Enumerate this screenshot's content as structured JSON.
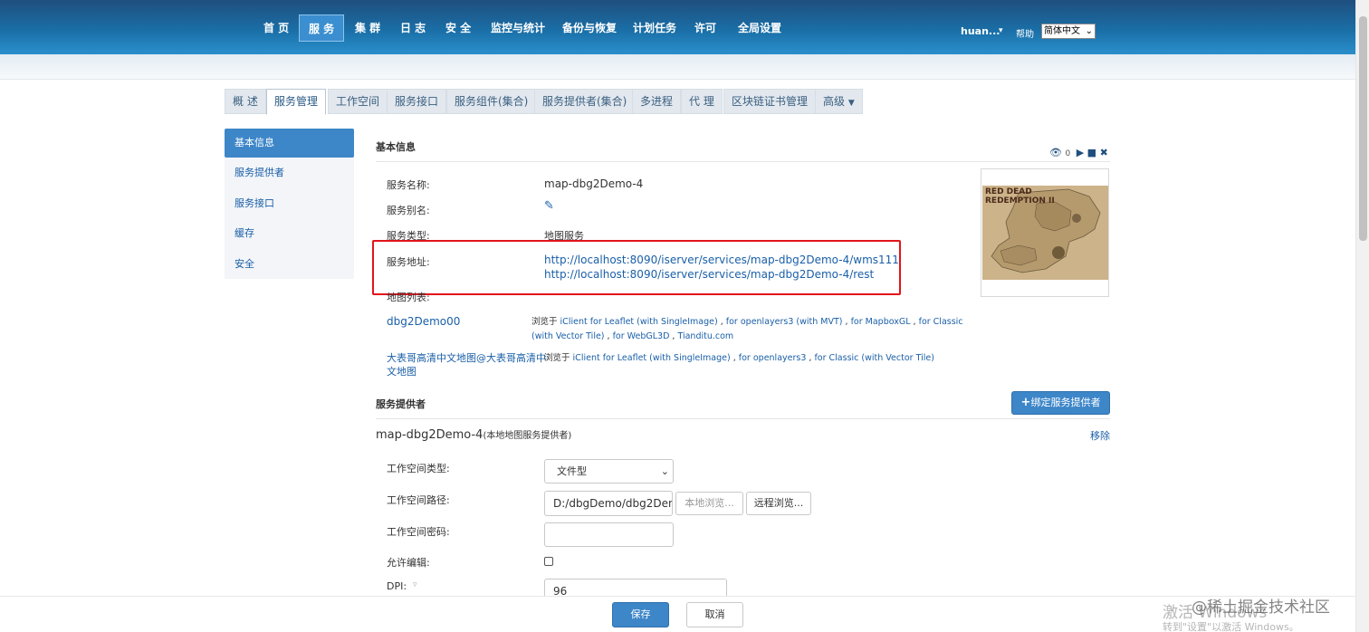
{
  "nav": {
    "items": [
      "首 页",
      "服 务",
      "集 群",
      "日 志",
      "安 全",
      "监控与统计",
      "备份与恢复",
      "计划任务",
      "许可",
      "全局设置"
    ],
    "user": "huan...",
    "help": "帮助",
    "language": "简体中文"
  },
  "tabs": [
    "概 述",
    "服务管理",
    "工作空间",
    "服务接口",
    "服务组件(集合)",
    "服务提供者(集合)",
    "多进程",
    "代 理",
    "区块链证书管理",
    "高级"
  ],
  "side_menu": [
    "基本信息",
    "服务提供者",
    "服务接口",
    "缓存",
    "安全"
  ],
  "basic_info": {
    "title": "基本信息",
    "view_count": "0",
    "name_label": "服务名称:",
    "name_value": "map-dbg2Demo-4",
    "alias_label": "服务别名:",
    "type_label": "服务类型:",
    "type_value": "地图服务",
    "address_label": "服务地址:",
    "address_wms": "http://localhost:8090/iserver/services/map-dbg2Demo-4/wms111",
    "address_rest": "http://localhost:8090/iserver/services/map-dbg2Demo-4/rest",
    "map_list_label": "地图列表:",
    "preview_title": "RED DEAD REDEMPTION II"
  },
  "maps": [
    {
      "name": "dbg2Demo00",
      "browse_prefix": "浏览于",
      "links": [
        "iClient for Leaflet (with SingleImage)",
        "for openlayers3 (with MVT)",
        "for MapboxGL",
        "for Classic (with Vector Tile)",
        "for WebGL3D",
        "Tianditu.com"
      ]
    },
    {
      "name_line1": "大表哥高清中文地图@大表哥高清中",
      "name_line2": "文地图",
      "browse_prefix": "浏览于",
      "links": [
        "iClient for Leaflet (with SingleImage)",
        "for openlayers3",
        "for Classic (with Vector Tile)"
      ]
    }
  ],
  "provider": {
    "section_title": "服务提供者",
    "bind_button": "绑定服务提供者",
    "name": "map-dbg2Demo-4",
    "type_note": "(本地地图服务提供者)",
    "remove": "移除",
    "workspace_type_label": "工作空间类型:",
    "workspace_type_value": "文件型",
    "workspace_path_label": "工作空间路径:",
    "workspace_path_value": "D:/dbgDemo/dbg2Den",
    "local_browse": "本地浏览...",
    "remote_browse": "远程浏览...",
    "workspace_password_label": "工作空间密码:",
    "allow_edit_label": "允许编辑:",
    "dpi_label": "DPI:",
    "dpi_value": "96"
  },
  "footer": {
    "save": "保存",
    "cancel": "取消"
  },
  "watermarks": {
    "activate": "激活 Windows",
    "activate_hint": "转到\"设置\"以激活 Windows。",
    "juejin": "@稀土掘金技术社区"
  },
  "colors": {
    "accent": "#3d86c8",
    "nav_bg": "#1a6ea6",
    "highlight_border": "#e2141b",
    "link": "#1a5fa8"
  }
}
